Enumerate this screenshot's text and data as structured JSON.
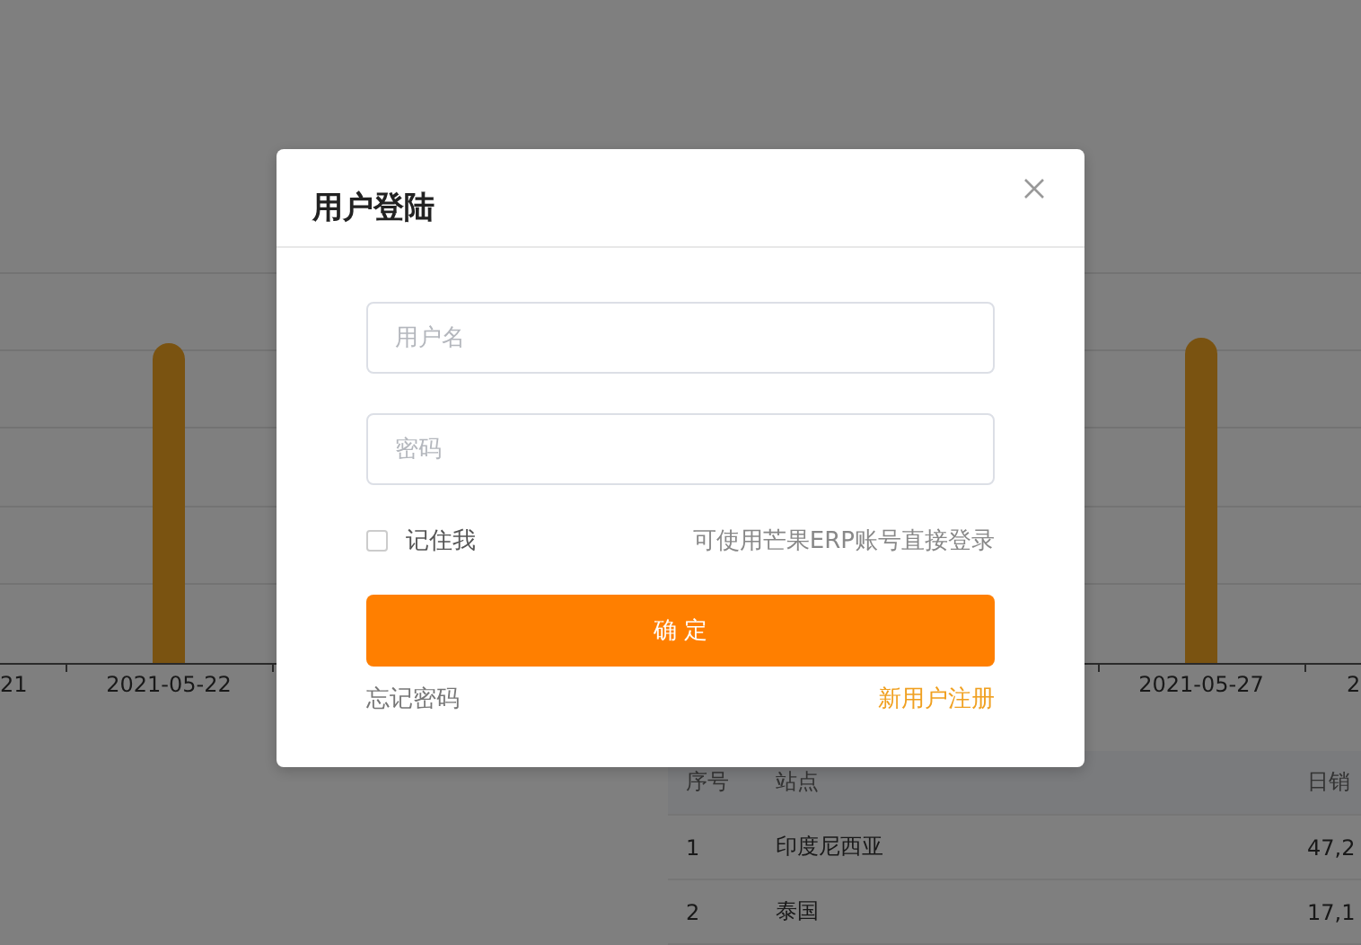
{
  "chart": {
    "x_labels": [
      "21",
      "2021-05-22",
      "2021-05-27",
      "2"
    ]
  },
  "table": {
    "columns": [
      "序号",
      "站点",
      "日销"
    ],
    "rows": [
      [
        "1",
        "印度尼西亚",
        "47,2"
      ],
      [
        "2",
        "泰国",
        "17,1"
      ]
    ]
  },
  "login_dialog": {
    "title": "用户登陆",
    "username": {
      "placeholder": "用户名"
    },
    "password": {
      "placeholder": "密码"
    },
    "remember_me": {
      "label": "记住我",
      "checked": false
    },
    "hint": "可使用芒果ERP账号直接登录",
    "submit": "确 定",
    "forgot_password": "忘记密码",
    "register": "新用户注册"
  }
}
